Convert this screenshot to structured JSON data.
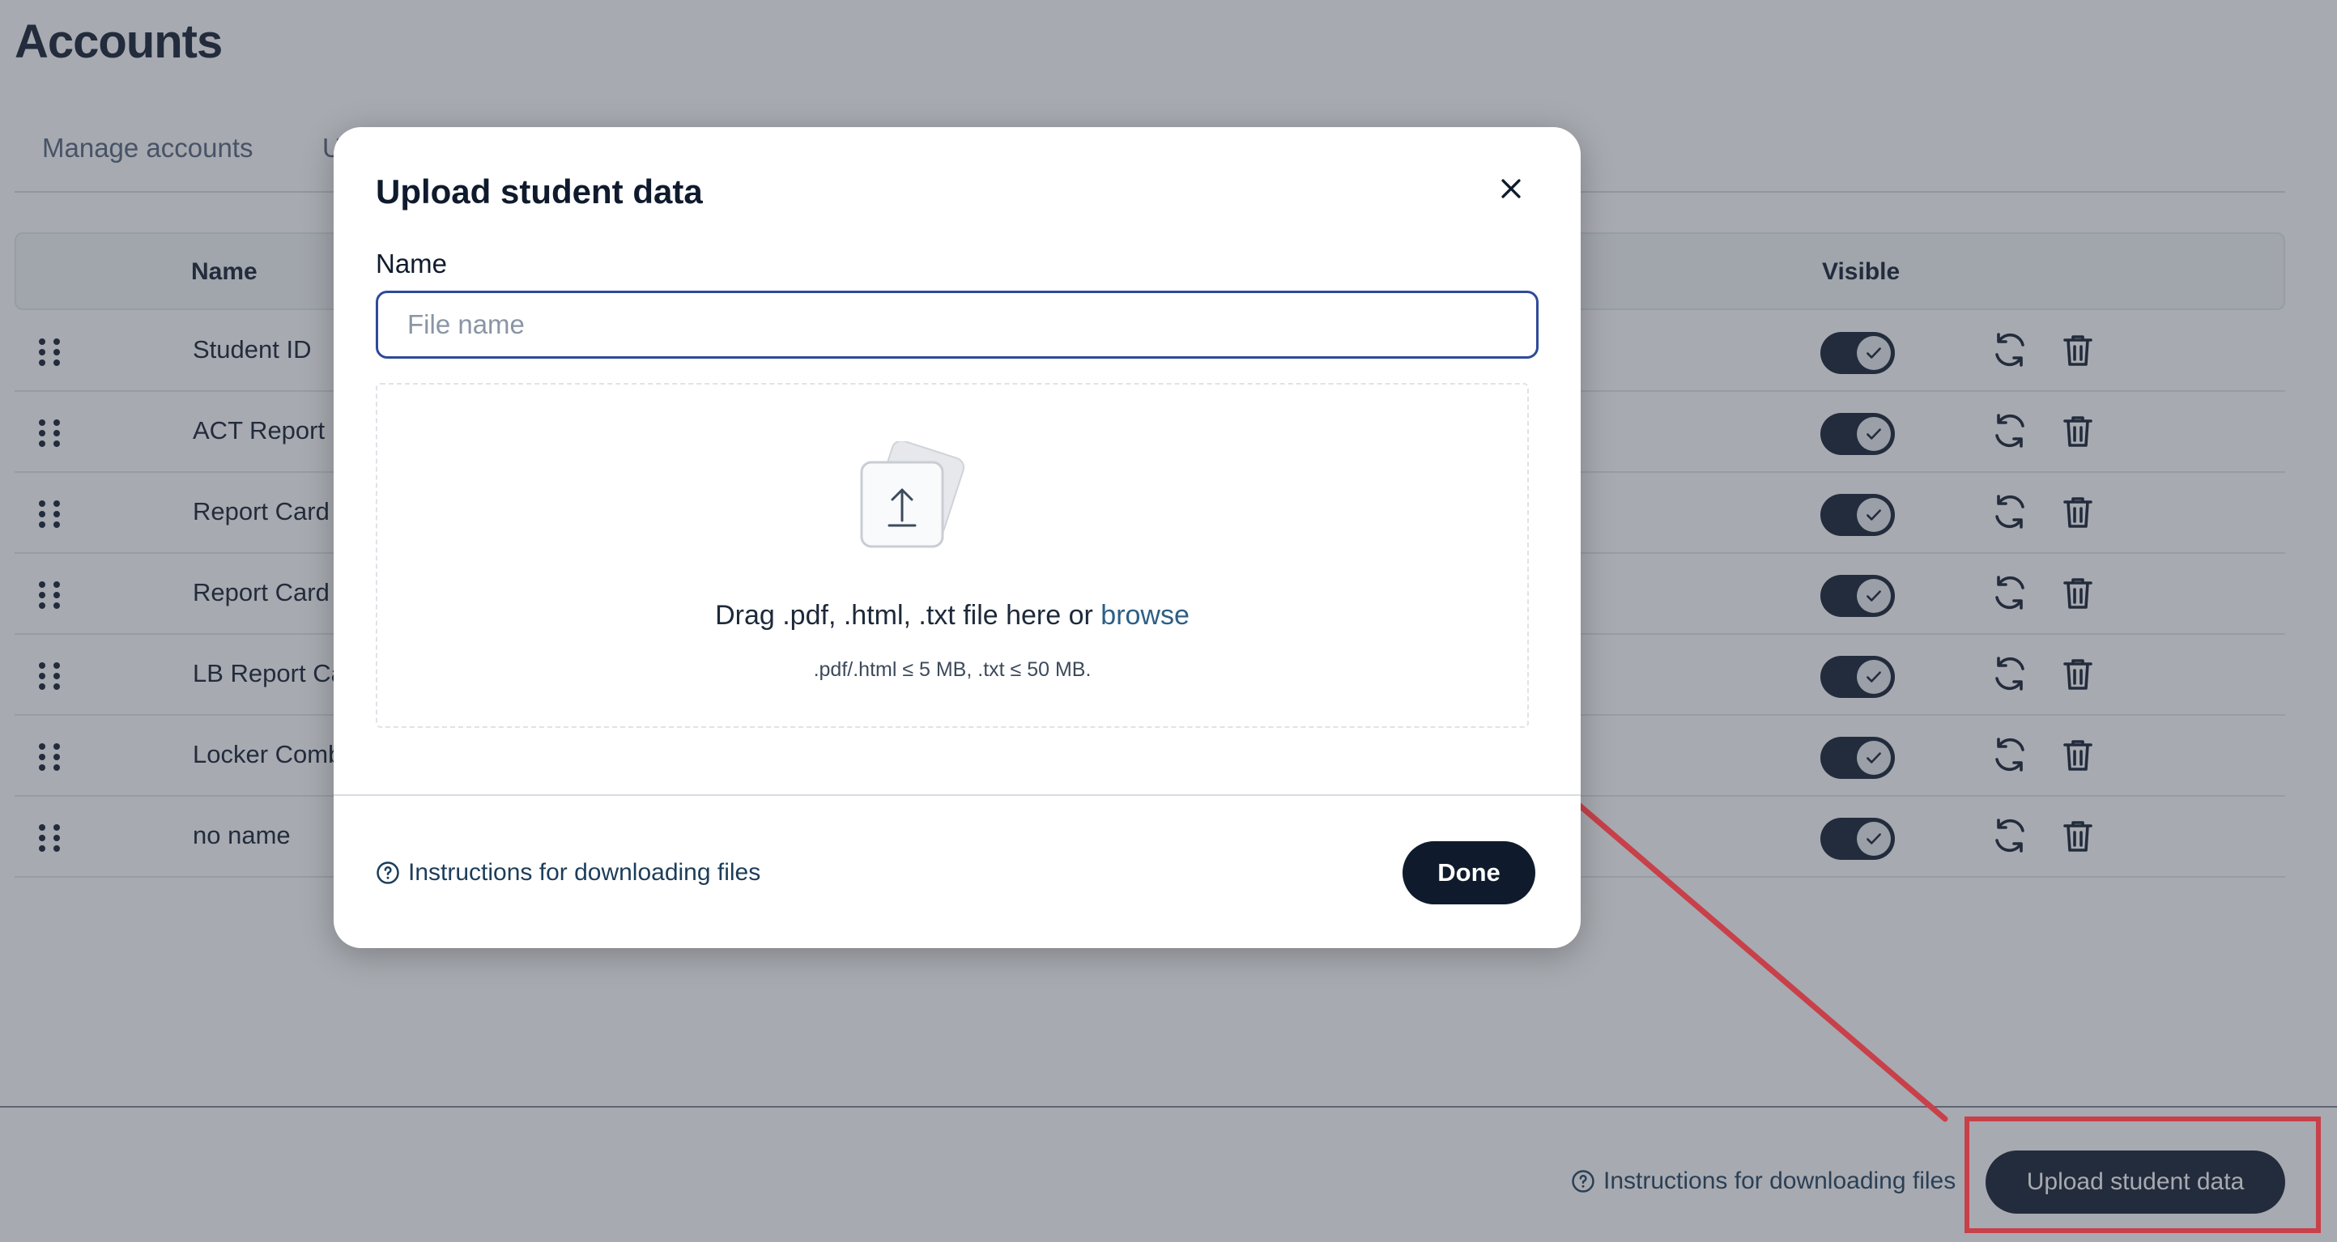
{
  "page": {
    "title": "Accounts",
    "tabs": [
      {
        "label": "Manage accounts"
      },
      {
        "label": "U"
      }
    ]
  },
  "table": {
    "headers": {
      "name": "Name",
      "visible": "Visible"
    },
    "rows": [
      {
        "name": "Student ID",
        "visible": true
      },
      {
        "name": "ACT Report",
        "visible": true
      },
      {
        "name": "Report Card",
        "visible": true
      },
      {
        "name": "Report Card",
        "visible": true
      },
      {
        "name": "LB Report Ca",
        "visible": true
      },
      {
        "name": "Locker Comb",
        "visible": true
      },
      {
        "name": "no name",
        "visible": true
      }
    ]
  },
  "footer": {
    "instructions_label": "Instructions for downloading files",
    "upload_label": "Upload student data"
  },
  "modal": {
    "title": "Upload student data",
    "name_label": "Name",
    "name_value": "",
    "name_placeholder": "File name",
    "drop_text_prefix": "Drag .pdf, .html, .txt file here or ",
    "browse_label": "browse",
    "drop_note": ".pdf/.html ≤ 5 MB, .txt ≤ 50 MB.",
    "instructions_label": "Instructions for downloading files",
    "done_label": "Done"
  },
  "colors": {
    "primary": "#0f1b2d",
    "link": "#2c5f86",
    "annotation": "#c8404a",
    "input_focus": "#2e4a9a"
  }
}
